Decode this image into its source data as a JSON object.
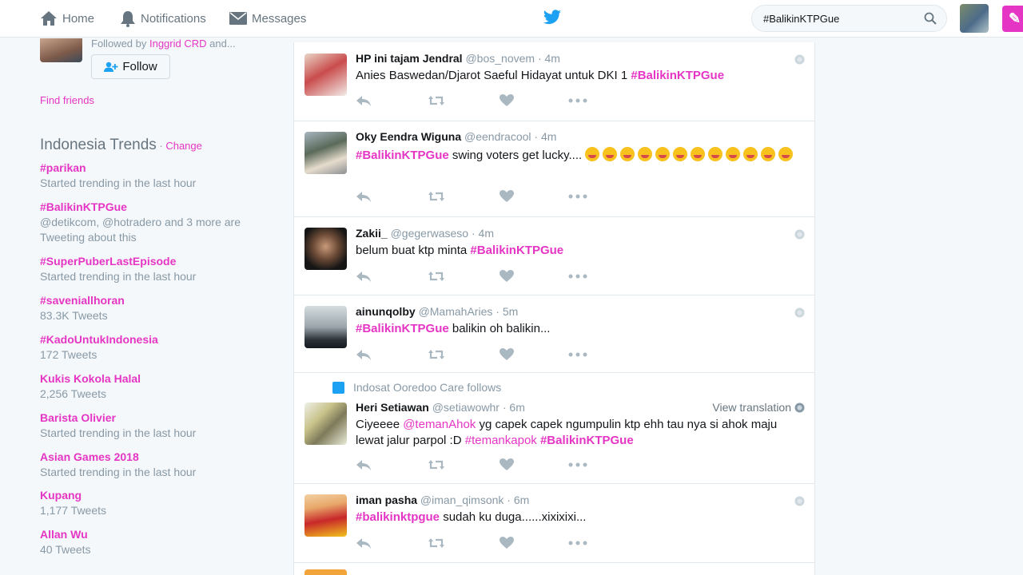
{
  "nav": {
    "home": "Home",
    "notifications": "Notifications",
    "messages": "Messages",
    "search_value": "#BalikinKTPGue",
    "brand_color": "#e535c4"
  },
  "who_to_follow": {
    "followed_by_prefix": "Followed by ",
    "followed_by_name": "Inggrid CRD",
    "followed_by_suffix": " and...",
    "follow_label": "Follow",
    "find_friends": "Find friends"
  },
  "trends": {
    "title": "Indonesia Trends",
    "separator": " · ",
    "change": "Change",
    "items": [
      {
        "name": "#parikan",
        "meta": "Started trending in the last hour"
      },
      {
        "name": "#BalikinKTPGue",
        "meta": "@detikcom, @hotradero and 3 more are",
        "meta2": "Tweeting about this"
      },
      {
        "name": "#SuperPuberLastEpisode",
        "meta": "Started trending in the last hour"
      },
      {
        "name": "#saveniallhoran",
        "meta": "83.3K Tweets"
      },
      {
        "name": "#KadoUntukIndonesia",
        "meta": "172 Tweets"
      },
      {
        "name": "Kukis Kokola Halal",
        "meta": "2,256 Tweets"
      },
      {
        "name": "Barista Olivier",
        "meta": "Started trending in the last hour"
      },
      {
        "name": "Asian Games 2018",
        "meta": "Started trending in the last hour"
      },
      {
        "name": "Kupang",
        "meta": "1,177 Tweets"
      },
      {
        "name": "Allan Wu",
        "meta": "40 Tweets"
      }
    ]
  },
  "tweets": [
    {
      "name": "HP ini tajam Jendral",
      "handle": "@bos_novem",
      "sep": " · ",
      "time": "4m",
      "text": "Anies Baswedan/Djarot Saeful Hidayat untuk DKI 1 ",
      "hashtag": "#BalikinKTPGue"
    },
    {
      "name": "Oky Eendra Wiguna",
      "handle": "@eendracool",
      "sep": " · ",
      "time": "4m",
      "hashtag": "#BalikinKTPGue",
      "text": " swing voters get lucky.... "
    },
    {
      "name": "Zakii_",
      "handle": "@gegerwaseso",
      "sep": " · ",
      "time": "4m",
      "text": "belum buat ktp minta ",
      "hashtag": "#BalikinKTPGue"
    },
    {
      "name": "ainunqolby",
      "handle": "@MamahAries",
      "sep": " · ",
      "time": "5m",
      "hashtag": "#BalikinKTPGue",
      "text": " balikin oh balikin..."
    },
    {
      "context": "Indosat Ooredoo Care follows",
      "name": "Heri Setiawan",
      "handle": "@setiawowhr",
      "sep": " · ",
      "time": "6m",
      "view_translation": "View translation",
      "text_a": "Ciyeeee ",
      "mention": "@temanAhok",
      "text_b": " yg capek capek ngumpulin ktp ehh tau nya si ahok maju",
      "text_c": "lewat jalur parpol :D ",
      "hashtag_a": "#temankapok",
      "hashtag_b": "#BalikinKTPGue"
    },
    {
      "name": "iman pasha",
      "handle": "@iman_qimsonk",
      "sep": " · ",
      "time": "6m",
      "hashtag": "#balikinktpgue",
      "text": " sudah ku duga......xixixixi..."
    }
  ]
}
